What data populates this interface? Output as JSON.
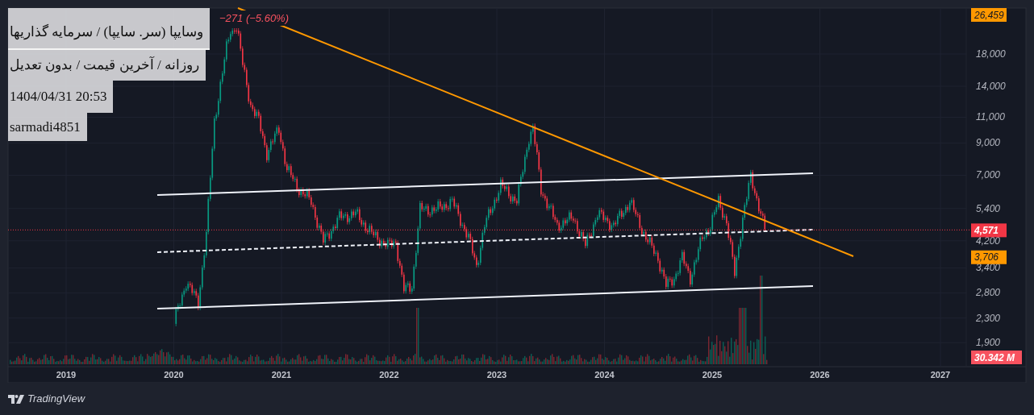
{
  "legend": {
    "change": "−271 (−5.60%)"
  },
  "notes": [
    {
      "text": "وسایپا (سر. سایپا) / سرمایه گذاریها"
    },
    {
      "text": "روزانه / آخرین قیمت / بدون تعدیل"
    },
    {
      "text": "1404/04/31 20:53"
    },
    {
      "text": "sarmadi4851"
    }
  ],
  "price_axis": {
    "labels": [
      "18,000",
      "14,000",
      "11,000",
      "9,000",
      "7,000",
      "5,400",
      "4,200",
      "3,400",
      "2,800",
      "2,300",
      "1,900"
    ]
  },
  "price_tags": [
    {
      "text": "26,459",
      "kind": "trendline"
    },
    {
      "text": "4,571",
      "kind": "last"
    },
    {
      "text": "3,706",
      "kind": "trendline"
    },
    {
      "text": "30.342 M",
      "kind": "volume"
    }
  ],
  "time_axis": {
    "labels": [
      "2019",
      "2020",
      "2021",
      "2022",
      "2023",
      "2024",
      "2025",
      "2026",
      "2027"
    ]
  },
  "branding": {
    "name": "TradingView"
  }
}
